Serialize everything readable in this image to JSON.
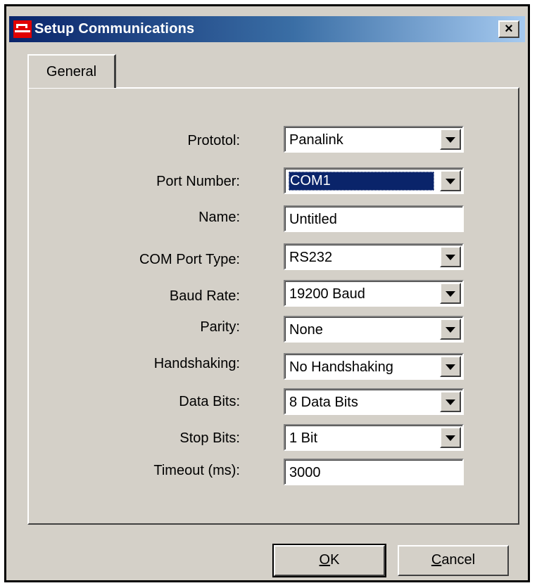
{
  "window": {
    "title": "Setup Communications",
    "app_icon": "app-logo-icon",
    "close_glyph": "×"
  },
  "tabs": [
    {
      "label": "General",
      "active": true
    }
  ],
  "form": {
    "protocol": {
      "label": "Prototol:",
      "value": "Panalink"
    },
    "port": {
      "label": "Port Number:",
      "value": "COM1"
    },
    "name": {
      "label": "Name:",
      "value": "Untitled"
    },
    "com_type": {
      "label": "COM Port Type:",
      "value": "RS232"
    },
    "baud": {
      "label": "Baud Rate:",
      "value": "19200 Baud"
    },
    "parity": {
      "label": "Parity:",
      "value": "None"
    },
    "handshake": {
      "label": "Handshaking:",
      "value": "No Handshaking"
    },
    "data_bits": {
      "label": "Data Bits:",
      "value": "8 Data Bits"
    },
    "stop_bits": {
      "label": "Stop Bits:",
      "value": "1 Bit"
    },
    "timeout": {
      "label": "Timeout (ms):",
      "value": "3000"
    }
  },
  "buttons": {
    "ok_mnemonic": "O",
    "ok_rest": "K",
    "cancel_mnemonic": "C",
    "cancel_rest": "ancel"
  },
  "colors": {
    "titlebar_start": "#0a246a",
    "titlebar_end": "#a6caf0",
    "face": "#d4d0c8",
    "selection": "#0a246a"
  }
}
